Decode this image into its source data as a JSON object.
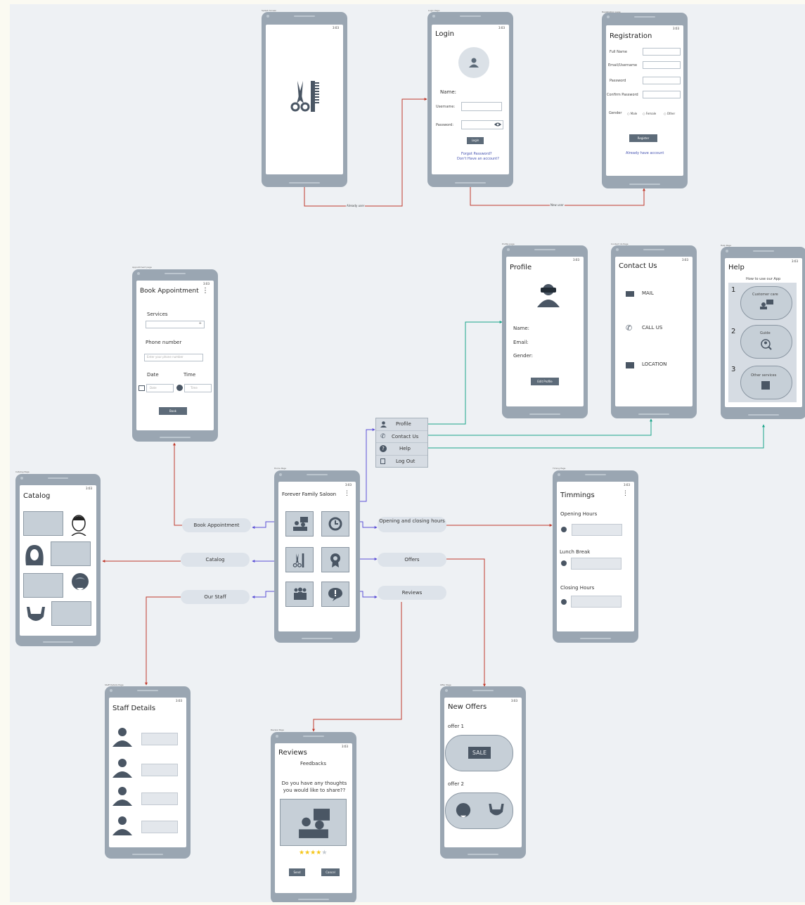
{
  "status_time": "3:03",
  "frame_labels": {
    "splash": "Splash Screen",
    "login": "Login Page",
    "registration": "Registration page",
    "appointment": "Appointment page",
    "profile": "Profile page",
    "contact": "Contact Us Page",
    "help": "Help Page",
    "catalog": "Catalog Page",
    "home": "Home Page",
    "timing": "Timing Page",
    "staff": "Staff Details Page",
    "review": "Review Page",
    "offer": "Offer Page"
  },
  "edges": {
    "already_user": "Already user",
    "new_user": "New user"
  },
  "login": {
    "title": "Login",
    "name_label": "Name:",
    "username_label": "Username:",
    "password_label": "Password:",
    "button": "Login",
    "forgot": "Forgot Password?",
    "no_account": "Don't Have an account?"
  },
  "registration": {
    "title": "Registration",
    "full_name": "Full Name",
    "email": "Email/Username",
    "password": "Password",
    "confirm": "Confirm Password",
    "gender": "Gender",
    "male": "Male",
    "female": "Female",
    "other": "Other",
    "button": "Register",
    "already": "Already have account"
  },
  "appointment": {
    "title": "Book Appointment",
    "services": "Services",
    "phone": "Phone number",
    "phone_placeholder": "Enter your phone number",
    "date": "Date",
    "time": "Time",
    "date_placeholder": "Date",
    "time_placeholder": "Time",
    "button": "Book"
  },
  "profile": {
    "title": "Profile",
    "name": "Name:",
    "email": "Email:",
    "gender": "Gender:",
    "button": "Edit Profile"
  },
  "contact": {
    "title": "Contact Us",
    "mail": "MAIL",
    "call": "CALL US",
    "location": "LOCATION"
  },
  "help": {
    "title": "Help",
    "subtitle": "How to use our App",
    "items": [
      {
        "num": "1",
        "label": "Customer care"
      },
      {
        "num": "2",
        "label": "Guide"
      },
      {
        "num": "3",
        "label": "Other services"
      }
    ]
  },
  "menu": {
    "items": [
      "Profile",
      "Contact Us",
      "Help",
      "Log Out"
    ]
  },
  "catalog": {
    "title": "Catalog"
  },
  "home": {
    "title": "Forever Family Saloon",
    "pills": {
      "book": "Book Appointment",
      "catalog": "Catalog",
      "staff": "Our Staff",
      "hours": "Opening and closing hours",
      "offers": "Offers",
      "reviews": "Reviews"
    }
  },
  "timing": {
    "title": "Timmings",
    "opening": "Opening Hours",
    "lunch": "Lunch Break",
    "closing": "Closing Hours"
  },
  "staff": {
    "title": "Staff Details"
  },
  "reviews": {
    "title": "Reviews",
    "subtitle": "Feedbacks",
    "question": "Do you have any thoughts you would like to share??",
    "rating": 4,
    "max_rating": 5,
    "send": "Send",
    "cancel": "Cancel"
  },
  "offers": {
    "title": "New Offers",
    "offer1": "offer 1",
    "sale": "SALE",
    "offer2": "offer 2"
  },
  "colors": {
    "red_edge": "#c0392b",
    "blue_edge": "#5b4fd6",
    "teal_edge": "#1aa58a",
    "icon": "#4a5664",
    "star": "#f5c518"
  }
}
